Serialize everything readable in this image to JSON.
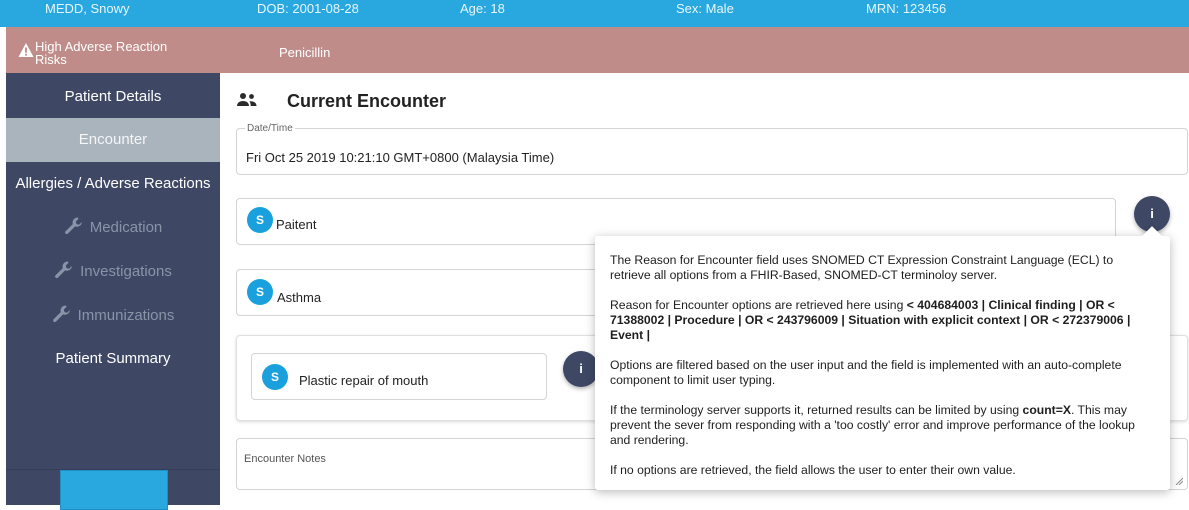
{
  "patient": {
    "name": "MEDD, Snowy",
    "dob": "DOB: 2001-08-28",
    "age": "Age: 18",
    "sex": "Sex: Male",
    "mrn": "MRN: 123456"
  },
  "allergy_banner": {
    "label": "High Adverse Reaction Risks",
    "allergen": "Penicillin",
    "icon": "warning-icon"
  },
  "sidebar": {
    "items": [
      {
        "label": "Patient Details",
        "state": "normal"
      },
      {
        "label": "Encounter",
        "state": "active"
      },
      {
        "label": "Allergies / Adverse Reactions",
        "state": "normal"
      },
      {
        "label": "Medication",
        "state": "disabled",
        "icon": "wrench-icon"
      },
      {
        "label": "Investigations",
        "state": "disabled",
        "icon": "wrench-icon"
      },
      {
        "label": "Immunizations",
        "state": "disabled",
        "icon": "wrench-icon"
      },
      {
        "label": "Patient Summary",
        "state": "normal"
      }
    ]
  },
  "main": {
    "title": "Current Encounter",
    "title_icon": "people-icon",
    "datetime": {
      "label": "Date/Time",
      "value": "Fri Oct 25 2019 10:21:10 GMT+0800 (Malaysia Time)"
    },
    "reason_chip": {
      "avatar": "S",
      "text": "Paitent"
    },
    "diagnosis_chip": {
      "avatar": "S",
      "text": "Asthma"
    },
    "procedure_chip": {
      "avatar": "S",
      "text": "Plastic repair of mouth"
    },
    "info_button_label": "i",
    "notes": {
      "label": "Encounter Notes"
    }
  },
  "tooltip": {
    "p1": "The Reason for Encounter field uses SNOMED CT Expression Constraint Language (ECL) to retrieve all options from a FHIR-Based, SNOMED-CT terminoloy server.",
    "p2_prefix": "Reason for Encounter options are retrieved here using ",
    "p2_ecl": "< 404684003 | Clinical finding | OR < 71388002 | Procedure | OR < 243796009 | Situation with explicit context | OR < 272379006 | Event |",
    "p3": "Options are filtered based on the user input and the field is implemented with an auto-complete component to limit user typing.",
    "p4_prefix": "If the terminology server supports it, returned results can be limited by using ",
    "p4_bold": "count=X",
    "p4_suffix": ". This may prevent the sever from responding with a 'too costly' error and improve performance of the lookup and rendering.",
    "p5": "If no options are retrieved, the field allows the user to enter their own value."
  },
  "colors": {
    "banner_blue": "#29a8e0",
    "allergy_rose": "#bf8c8a",
    "sidebar_navy": "#3e4865",
    "active_grey": "#aab4bc",
    "chip_blue": "#1aa0dc"
  }
}
